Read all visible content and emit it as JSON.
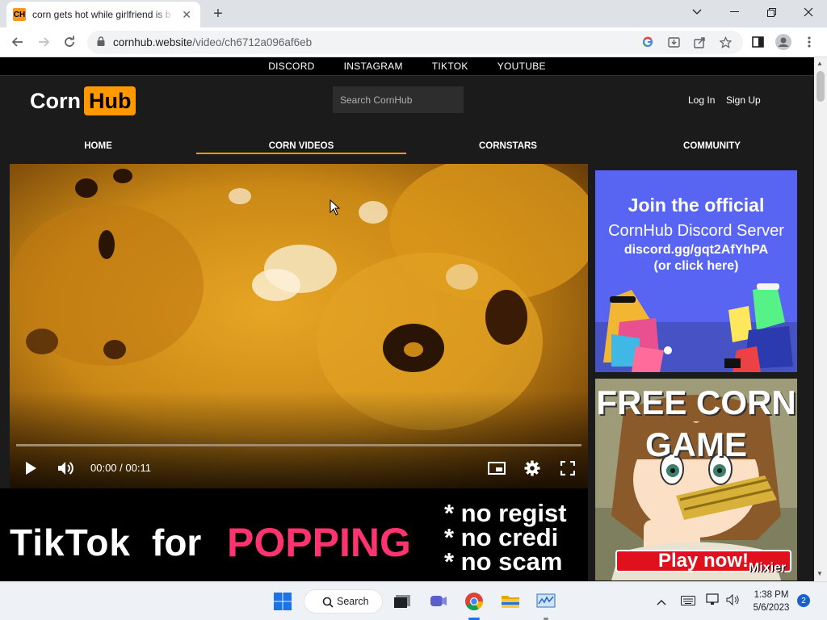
{
  "browser": {
    "tab_title": "corn gets hot while girlfriend is b",
    "favicon_text": "CH",
    "url_host": "cornhub.website",
    "url_path": "/video/ch6712a096af6eb"
  },
  "site": {
    "top_links": [
      "DISCORD",
      "INSTAGRAM",
      "TIKTOK",
      "YOUTUBE"
    ],
    "logo_a": "Corn",
    "logo_b": "Hub",
    "search_placeholder": "Search CornHub",
    "login": "Log In",
    "signup": "Sign Up",
    "main_nav": [
      "HOME",
      "CORN VIDEOS",
      "CORNSTARS",
      "COMMUNITY"
    ],
    "active_nav": "CORN VIDEOS",
    "accent": "#ff9900"
  },
  "video": {
    "time": "00:00 / 00:11",
    "progress": 0
  },
  "banner": {
    "left_text": "TikTok",
    "for_text": "for",
    "popping_text": "POPPING",
    "bullets": [
      "* no regist",
      "* no credi",
      "* no scam"
    ]
  },
  "ad1": {
    "line1": "Join the official",
    "line2": "CornHub Discord Server",
    "line3": "discord.gg/gqt2AfYhPA",
    "line4": "(or click here)"
  },
  "ad2": {
    "line1": "FREE CORN",
    "line2": "GAME",
    "cta": "Play now!",
    "brand": "Mixier"
  },
  "taskbar": {
    "search_label": "Search",
    "time": "1:38 PM",
    "date": "5/6/2023",
    "notifications": "2"
  }
}
